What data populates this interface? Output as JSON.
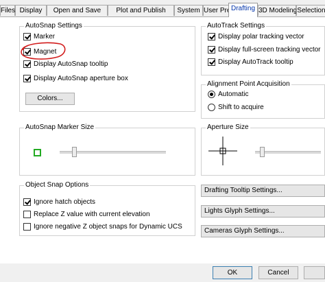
{
  "tabs": [
    {
      "label": "Files"
    },
    {
      "label": "Display"
    },
    {
      "label": "Open and Save"
    },
    {
      "label": "Plot and Publish"
    },
    {
      "label": "System"
    },
    {
      "label": "User Preferences"
    },
    {
      "label": "Drafting",
      "active": true
    },
    {
      "label": "3D Modeling"
    },
    {
      "label": "Selection"
    }
  ],
  "autosnap": {
    "title": "AutoSnap Settings",
    "marker": {
      "label": "Marker",
      "checked": true
    },
    "magnet": {
      "label": "Magnet",
      "checked": true
    },
    "tooltip": {
      "label": "Display AutoSnap tooltip",
      "checked": true
    },
    "aperture_box": {
      "label": "Display AutoSnap aperture box",
      "checked": true
    },
    "colors_button": "Colors..."
  },
  "autotrack": {
    "title": "AutoTrack Settings",
    "polar": {
      "label": "Display polar tracking vector",
      "checked": true
    },
    "fullscreen": {
      "label": "Display full-screen tracking vector",
      "checked": true
    },
    "tooltip": {
      "label": "Display AutoTrack tooltip",
      "checked": true
    }
  },
  "alignment": {
    "title": "Alignment Point Acquisition",
    "automatic": {
      "label": "Automatic",
      "selected": true
    },
    "shift": {
      "label": "Shift to acquire",
      "selected": false
    }
  },
  "marker_size": {
    "title": "AutoSnap Marker Size",
    "level": 0.12
  },
  "aperture_size": {
    "title": "Aperture Size",
    "level": 0.08
  },
  "object_snap": {
    "title": "Object Snap Options",
    "ignore_hatch": {
      "label": "Ignore hatch objects",
      "checked": true
    },
    "replace_z": {
      "label": "Replace Z value with current elevation",
      "checked": false
    },
    "ignore_negative_z": {
      "label": "Ignore negative Z object snaps for Dynamic UCS",
      "checked": false
    }
  },
  "buttons": {
    "drafting_tooltip": "Drafting Tooltip Settings...",
    "lights_glyph": "Lights Glyph Settings...",
    "cameras_glyph": "Cameras Glyph Settings...",
    "ok": "OK",
    "cancel": "Cancel"
  },
  "colors": {
    "highlight": "#d21c1c",
    "marker_green": "#22aa22",
    "active_tab": "#0033aa"
  }
}
